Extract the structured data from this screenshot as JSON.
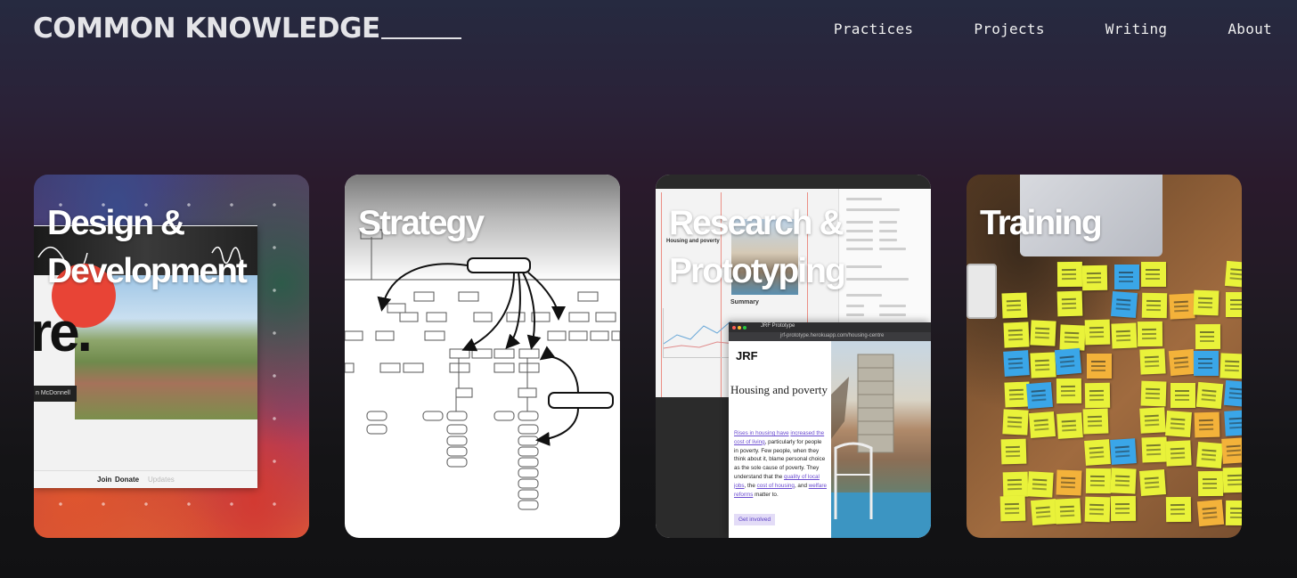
{
  "header": {
    "logo": "COMMON KNOWLEDGE",
    "nav": [
      "Practices",
      "Projects",
      "Writing",
      "About"
    ]
  },
  "cards": [
    {
      "title": "Design & Development",
      "artwork": {
        "headline_fragment": "re.",
        "name_fragment": "n McDonnell",
        "bottom_links": [
          "Join",
          "Donate",
          "Updates"
        ]
      }
    },
    {
      "title": "Strategy"
    },
    {
      "title": "Research & Prototyping",
      "artwork": {
        "thumb_title": "Housing and poverty",
        "summary_label": "Summary",
        "browser_tab": "JRF Prototype",
        "browser_url": "jrf-prototype.herokuapp.com/housing-centre",
        "org": "JRF",
        "heading": "Housing and poverty",
        "tag": "Rises in housing have increased the cost of living",
        "body_parts": [
          {
            "text": "Rises in housing have",
            "hl": true
          },
          {
            "text": " ",
            "hl": false
          },
          {
            "text": "increased the cost of living",
            "hl": true
          },
          {
            "text": ", particularly for people in poverty. Few people, when they think about it, blame personal choice as the sole cause of poverty. They understand that the ",
            "hl": false
          },
          {
            "text": "quality of local jobs",
            "hl": true
          },
          {
            "text": ", the ",
            "hl": false
          },
          {
            "text": "cost of housing",
            "hl": true
          },
          {
            "text": ", and ",
            "hl": false
          },
          {
            "text": "welfare reforms",
            "hl": true
          },
          {
            "text": " matter to.",
            "hl": false
          }
        ],
        "cta": "Get involved"
      }
    },
    {
      "title": "Training"
    }
  ],
  "colors": {
    "text": "#ececec",
    "note_yellow": "#e9f23a",
    "note_blue": "#3aa6e8",
    "note_orange": "#f3b23a"
  }
}
